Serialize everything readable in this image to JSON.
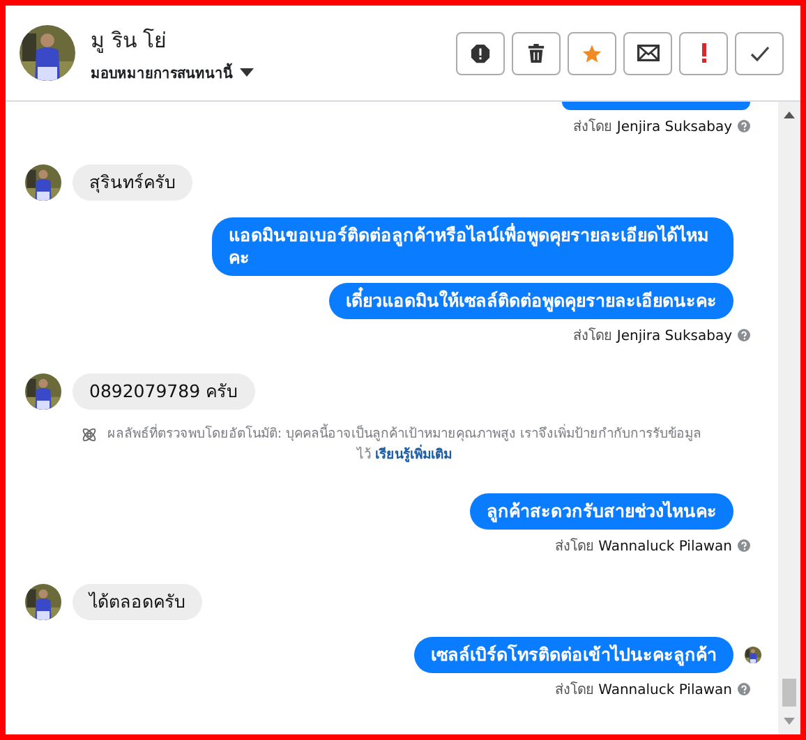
{
  "header": {
    "name": "มู ริน โย่",
    "assign_label": "มอบหมายการสนทนานี้",
    "actions": [
      {
        "kind": "spam"
      },
      {
        "kind": "delete"
      },
      {
        "kind": "star"
      },
      {
        "kind": "mail"
      },
      {
        "kind": "important"
      },
      {
        "kind": "done"
      }
    ]
  },
  "messages": [
    {
      "kind": "cutoff"
    },
    {
      "kind": "sender",
      "text": "ส่งโดย **Jenjira Suksabay**"
    },
    {
      "kind": "incoming",
      "text": "สุรินทร์ครับ"
    },
    {
      "kind": "outgoing",
      "text": "แอดมินขอเบอร์ติดต่อลูกค้าหรือไลน์เพื่อพูดคุยรายละเอียดได้ไหมคะ"
    },
    {
      "kind": "outgoing",
      "text": "เดี๋ยวแอดมินให้เซลล์ติดต่อพูดคุยรายละเอียดนะคะ"
    },
    {
      "kind": "sender",
      "text": "ส่งโดย **Jenjira Suksabay**"
    },
    {
      "kind": "incoming",
      "text": "0892079789 ครับ"
    },
    {
      "kind": "notice",
      "text": "ผลลัพธ์ที่ตรวจพบโดยอัตโนมัติ: บุคคลนี้อาจเป็นลูกค้าเป้าหมายคุณภาพสูง เราจึงเพิ่มป้ายกำกับการรับข้อมูลไว้",
      "link": "เรียนรู้เพิ่มเติม"
    },
    {
      "kind": "outgoing",
      "text": "ลูกค้าสะดวกรับสายช่วงไหนคะ"
    },
    {
      "kind": "sender",
      "text": "ส่งโดย **Wannaluck Pilawan**"
    },
    {
      "kind": "incoming",
      "text": "ได้ตลอดครับ"
    },
    {
      "kind": "outgoing",
      "text": "เซลล์เบิร์ดโทรติดต่อเข้าไปนะคะลูกค้า",
      "seen": true
    },
    {
      "kind": "sender",
      "text": "ส่งโดย **Wannaluck Pilawan**"
    }
  ]
}
